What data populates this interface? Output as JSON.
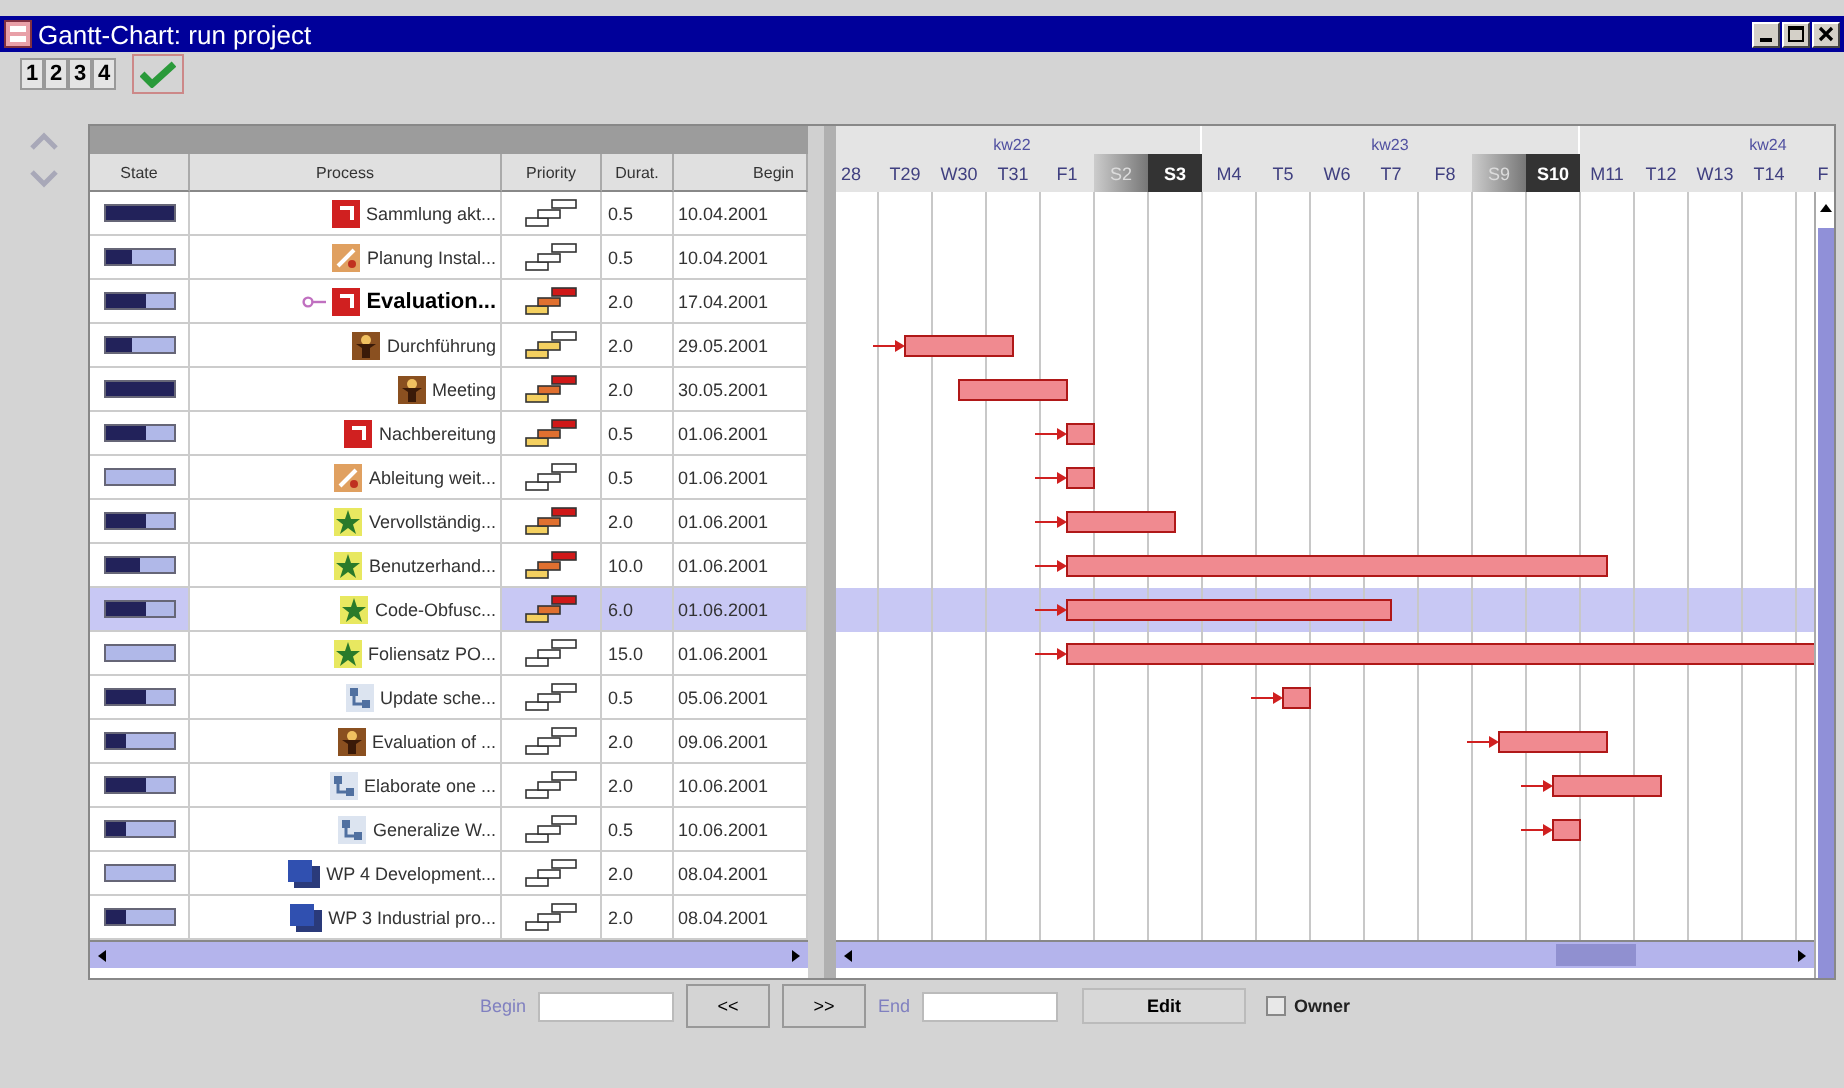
{
  "window": {
    "title": "Gantt-Chart: run project"
  },
  "toolbar": {
    "view_buttons": [
      "1",
      "2",
      "3",
      "4"
    ]
  },
  "table": {
    "columns": [
      "State",
      "Process",
      "Priority",
      "Durat.",
      "Begin"
    ],
    "rows": [
      {
        "level": 1.0,
        "kind": "document",
        "process": "Sammlung akt...",
        "priority": {
          "kind": "low"
        },
        "duration": "0.5",
        "begin": "10.04.2001",
        "selected": false,
        "pinned": false
      },
      {
        "level": 0.4,
        "kind": "tools",
        "process": "Planung Instal...",
        "priority": {
          "kind": "low"
        },
        "duration": "0.5",
        "begin": "10.04.2001",
        "selected": false,
        "pinned": false
      },
      {
        "level": 0.6,
        "kind": "document",
        "process": "Evaluation...",
        "priority": {
          "kind": "high"
        },
        "duration": "2.0",
        "begin": "17.04.2001",
        "selected": false,
        "pinned": true
      },
      {
        "level": 0.4,
        "kind": "figure",
        "process": "Durchführung",
        "priority": {
          "kind": "medium"
        },
        "duration": "2.0",
        "begin": "29.05.2001",
        "selected": false,
        "pinned": false,
        "linked": true
      },
      {
        "level": 1.0,
        "kind": "figure",
        "process": "Meeting",
        "priority": {
          "kind": "high"
        },
        "duration": "2.0",
        "begin": "30.05.2001",
        "selected": false,
        "pinned": false,
        "linked": false
      },
      {
        "level": 0.6,
        "kind": "document",
        "process": "Nachbereitung",
        "priority": {
          "kind": "high"
        },
        "duration": "0.5",
        "begin": "01.06.2001",
        "selected": false,
        "pinned": false,
        "linked": true
      },
      {
        "kind": "tools",
        "process": "Ableitung weit...",
        "priority": {
          "kind": "low"
        },
        "duration": "0.5",
        "begin": "01.06.2001",
        "selected": false,
        "pinned": false,
        "linked": true
      },
      {
        "level": 0.6,
        "kind": "star",
        "process": "Vervollständig...",
        "priority": {
          "kind": "high"
        },
        "duration": "2.0",
        "begin": "01.06.2001",
        "selected": false,
        "pinned": false,
        "linked": true
      },
      {
        "level": 0.5,
        "kind": "star",
        "process": "Benutzerhand...",
        "priority": {
          "kind": "high"
        },
        "duration": "10.0",
        "begin": "01.06.2001",
        "selected": false,
        "pinned": false,
        "linked": true
      },
      {
        "level": 0.6,
        "kind": "star",
        "process": "Code-Obfusc...",
        "priority": {
          "kind": "high"
        },
        "duration": "6.0",
        "begin": "01.06.2001",
        "selected": true,
        "pinned": false,
        "linked": true
      },
      {
        "kind": "star",
        "process": "Foliensatz PO...",
        "priority": {
          "kind": "low"
        },
        "duration": "15.0",
        "begin": "01.06.2001",
        "selected": false,
        "pinned": false,
        "linked": true
      },
      {
        "level": 0.6,
        "kind": "network",
        "process": "Update sche...",
        "priority": {
          "kind": "low"
        },
        "duration": "0.5",
        "begin": "05.06.2001",
        "selected": false,
        "pinned": false,
        "linked": true
      },
      {
        "level": 0.3,
        "kind": "figure",
        "process": "Evaluation of ...",
        "priority": {
          "kind": "low"
        },
        "duration": "2.0",
        "begin": "09.06.2001",
        "selected": false,
        "pinned": false,
        "linked": true
      },
      {
        "level": 0.6,
        "kind": "network",
        "process": "Elaborate one ...",
        "priority": {
          "kind": "low"
        },
        "duration": "2.0",
        "begin": "10.06.2001",
        "selected": false,
        "pinned": false,
        "linked": true
      },
      {
        "level": 0.3,
        "kind": "network",
        "process": "Generalize W...",
        "priority": {
          "kind": "low"
        },
        "duration": "0.5",
        "begin": "10.06.2001",
        "selected": false,
        "pinned": false,
        "linked": true
      },
      {
        "kind": "package",
        "process": "WP 4 Development...",
        "priority": {
          "kind": "low"
        },
        "duration": "2.0",
        "begin": "08.04.2001",
        "selected": false,
        "pinned": false
      },
      {
        "level": 0.3,
        "kind": "package",
        "process": "WP 3 Industrial pro...",
        "priority": {
          "kind": "low"
        },
        "duration": "2.0",
        "begin": "08.04.2001",
        "selected": false,
        "pinned": false
      }
    ]
  },
  "timeline": {
    "weeks": [
      "kw22",
      "kw23",
      "kw24"
    ],
    "days": [
      {
        "label": "28",
        "kind": "weekday"
      },
      {
        "label": "T29",
        "kind": "weekday"
      },
      {
        "label": "W30",
        "kind": "weekday"
      },
      {
        "label": "T31",
        "kind": "weekday"
      },
      {
        "label": "F1",
        "kind": "weekday"
      },
      {
        "label": "S2",
        "kind": "saturday"
      },
      {
        "label": "S3",
        "kind": "sunday"
      },
      {
        "label": "M4",
        "kind": "weekday"
      },
      {
        "label": "T5",
        "kind": "weekday"
      },
      {
        "label": "W6",
        "kind": "weekday"
      },
      {
        "label": "T7",
        "kind": "weekday"
      },
      {
        "label": "F8",
        "kind": "weekday"
      },
      {
        "label": "S9",
        "kind": "saturday"
      },
      {
        "label": "S10",
        "kind": "sunday"
      },
      {
        "label": "M11",
        "kind": "weekday"
      },
      {
        "label": "T12",
        "kind": "weekday"
      },
      {
        "label": "W13",
        "kind": "weekday"
      },
      {
        "label": "T14",
        "kind": "weekday"
      },
      {
        "label": "F",
        "kind": "weekday"
      }
    ]
  },
  "footer": {
    "begin_label": "Begin",
    "prev_button": "<<",
    "next_button": ">>",
    "end_label": "End",
    "edit_button": "Edit",
    "owner": {
      "label": "Owner",
      "checked": false
    }
  }
}
